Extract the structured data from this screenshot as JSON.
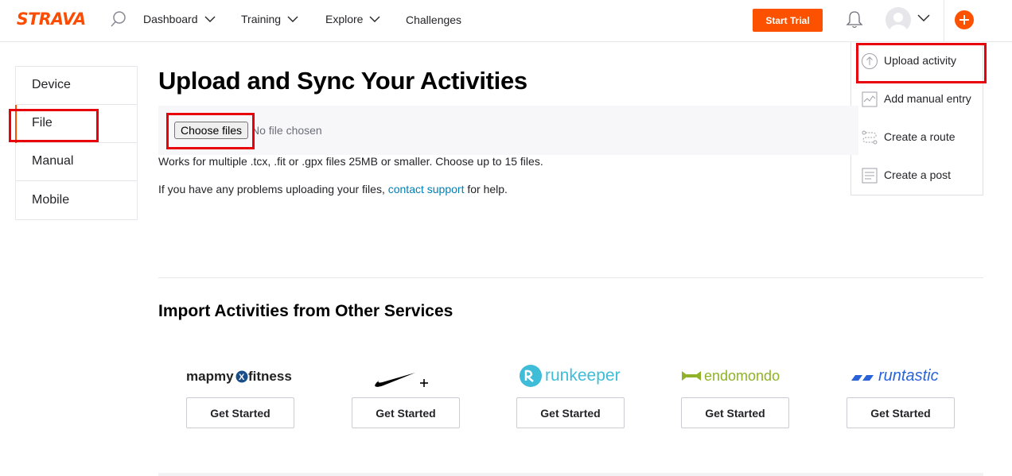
{
  "header": {
    "logo_text": "STRAVA",
    "nav": [
      {
        "label": "Dashboard"
      },
      {
        "label": "Training"
      },
      {
        "label": "Explore"
      },
      {
        "label": "Challenges"
      }
    ],
    "start_trial_label": "Start Trial",
    "icons": [
      "search-icon",
      "bell-icon",
      "avatar-icon",
      "chevron-down-icon",
      "plus-icon"
    ]
  },
  "dropdown": {
    "items": [
      {
        "label": "Upload activity",
        "icon": "upload-icon"
      },
      {
        "label": "Add manual entry",
        "icon": "manual-entry-icon"
      },
      {
        "label": "Create a route",
        "icon": "route-icon"
      },
      {
        "label": "Create a post",
        "icon": "post-icon"
      }
    ]
  },
  "sidebar": {
    "items": [
      {
        "label": "Device"
      },
      {
        "label": "File",
        "active": true
      },
      {
        "label": "Manual"
      },
      {
        "label": "Mobile"
      }
    ]
  },
  "main": {
    "title": "Upload and Sync Your Activities",
    "choose_files_label": "Choose files",
    "no_file_text": "No file chosen",
    "info_text": "Works for multiple .tcx, .fit or .gpx files 25MB or smaller. Choose up to 15 files.",
    "help_prefix": "If you have any problems uploading your files,",
    "help_link": "contact support",
    "help_suffix": "for help."
  },
  "import": {
    "title": "Import Activities from Other Services",
    "services": [
      {
        "name": "mapmyfitness",
        "button": "Get Started"
      },
      {
        "name": "nike+",
        "button": "Get Started"
      },
      {
        "name": "runkeeper",
        "button": "Get Started"
      },
      {
        "name": "endomondo",
        "button": "Get Started"
      },
      {
        "name": "runtastic",
        "button": "Get Started"
      }
    ]
  },
  "colors": {
    "brand": "#fc5200",
    "link": "#007fb6",
    "highlight": "#e8000b"
  }
}
